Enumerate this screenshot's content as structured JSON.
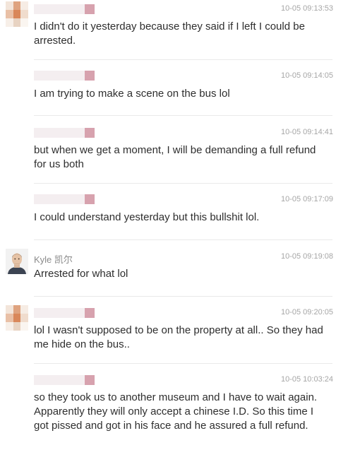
{
  "messages": [
    {
      "sender": "",
      "time": "10-05 09:13:53",
      "text": "I didn't do it yesterday because they said if I left I could be arrested."
    },
    {
      "sender": "",
      "time": "10-05 09:14:05",
      "text": "I am trying to make a scene on the bus lol"
    },
    {
      "sender": "",
      "time": "10-05 09:14:41",
      "text": "but when we get a moment, I will be demanding a full refund for us both"
    },
    {
      "sender": "",
      "time": "10-05 09:17:09",
      "text": "I could understand yesterday but this bullshit lol."
    },
    {
      "sender": "Kyle 凯尔",
      "time": "10-05 09:19:08",
      "text": "Arrested for what lol"
    },
    {
      "sender": "",
      "time": "10-05 09:20:05",
      "text": "lol I wasn't supposed to be on the property at all.. So they had me hide on the bus.."
    },
    {
      "sender": "",
      "time": "10-05 10:03:24",
      "text": "so they took us to another museum and I have to wait again. Apparently they will only accept a chinese I.D. So this time I got pissed and got in his face and he assured a full refund."
    }
  ],
  "colors": {
    "blur_light": "#f4eef0",
    "blur_pink": "#d7a2ae",
    "avatar_orange": "#d9875a",
    "avatar_tan": "#e8c7a8",
    "separator": "#e9e9e9"
  },
  "icons": {
    "blurred_avatar": "pixelated-avatar-icon",
    "kyle_avatar": "man-portrait-avatar"
  }
}
